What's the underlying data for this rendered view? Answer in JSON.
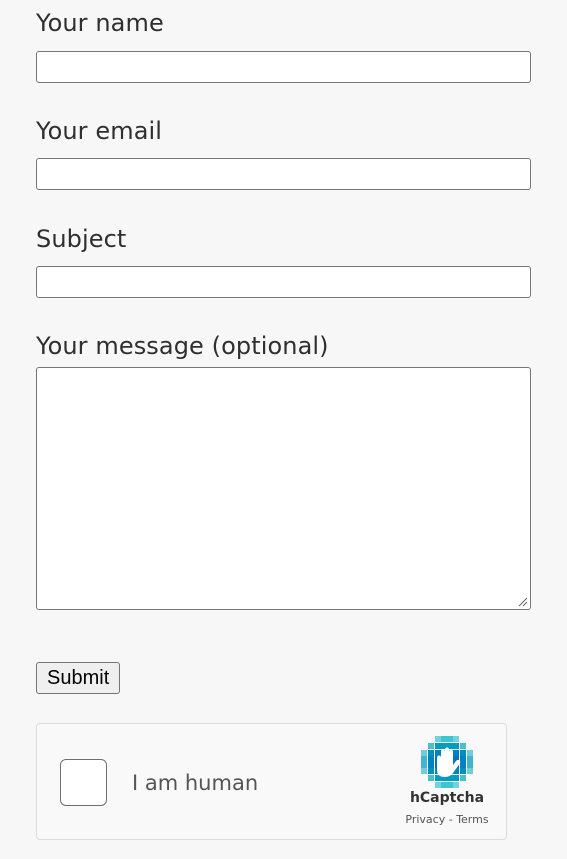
{
  "form": {
    "name_label": "Your name",
    "name_value": "",
    "email_label": "Your email",
    "email_value": "",
    "subject_label": "Subject",
    "subject_value": "",
    "message_label": "Your message (optional)",
    "message_value": "",
    "submit_label": "Submit"
  },
  "captcha": {
    "checkbox_label": "I am human",
    "brand": "hCaptcha",
    "privacy_link": "Privacy",
    "separator": " - ",
    "terms_link": "Terms",
    "logo_icon": "hcaptcha-hand-icon",
    "logo_colors": [
      "#0074bf",
      "#0082bf",
      "#008fbf",
      "#009dbf",
      "#00a7bf",
      "#00b3c4"
    ]
  }
}
